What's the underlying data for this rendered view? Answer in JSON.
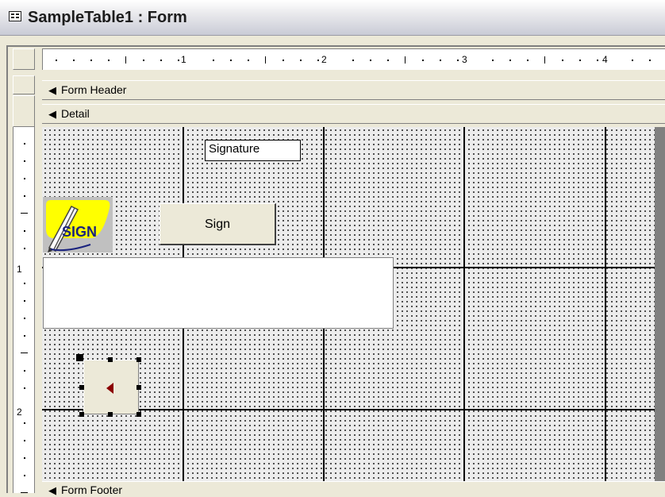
{
  "window": {
    "title": "SampleTable1 : Form",
    "icon": "form-icon"
  },
  "ruler": {
    "horizontal_numbers": [
      "1",
      "2",
      "3",
      "4"
    ],
    "vertical_numbers": [
      "1",
      "2"
    ]
  },
  "sections": {
    "header": "Form Header",
    "detail": "Detail",
    "footer": "Form Footer",
    "arrow_glyph": "◀"
  },
  "controls": {
    "signature_textbox": "Signature",
    "sign_button": "Sign",
    "sign_logo_text": "SIGN",
    "nav_button_icon": "left-arrow-icon"
  },
  "colors": {
    "logo_yellow": "#ffff00",
    "logo_text": "#1a237e",
    "nav_arrow": "#8b0000",
    "grid_line": "#000000"
  }
}
